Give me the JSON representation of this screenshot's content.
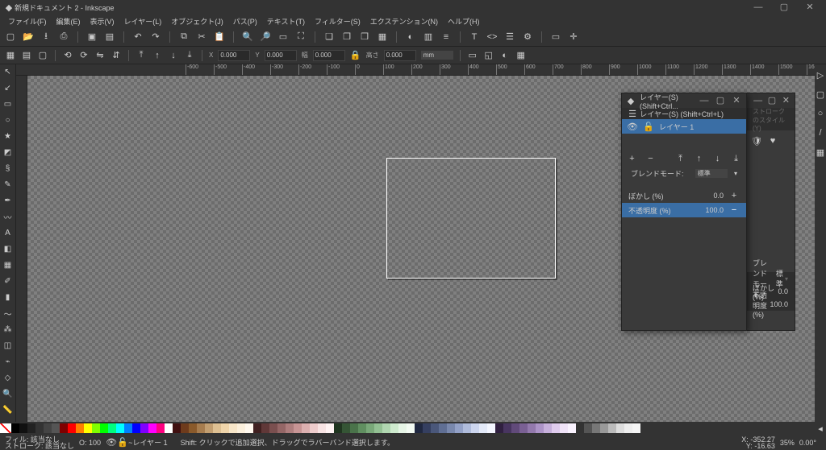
{
  "titlebar": {
    "title": "新規ドキュメント 2 - Inkscape"
  },
  "menu": {
    "file": "ファイル(F)",
    "edit": "編集(E)",
    "view": "表示(V)",
    "layer": "レイヤー(L)",
    "object": "オブジェクト(J)",
    "path": "パス(P)",
    "text": "テキスト(T)",
    "filter": "フィルター(S)",
    "extension": "エクステンション(N)",
    "help": "ヘルプ(H)"
  },
  "toolbar2": {
    "x_lbl": "X",
    "x": "0.000",
    "y_lbl": "Y",
    "y": "0.000",
    "w_lbl": "幅",
    "w": "0.000",
    "h_lbl": "高さ",
    "h": "0.000",
    "unit": "mm"
  },
  "panel_layers": {
    "title": "レイヤー(S) (Shift+Ctrl...",
    "subtitle": "レイヤー(S) (Shift+Ctrl+L)",
    "layer_name": "レイヤー 1",
    "blend_label": "ブレンドモード:",
    "blend_val": "標準",
    "blur_label": "ぼかし (%)",
    "blur_val": "0.0",
    "opacity_label": "不透明度 (%)",
    "opacity_val": "100.0"
  },
  "panel_fill": {
    "stroke_style": "ストロークのスタイル(Y)",
    "blend_label": "ブレンドモード:",
    "blend_val": "標準",
    "blur_label": "ぼかし (%)",
    "blur_val": "0.0",
    "opacity_label": "不透明度(%)",
    "opacity_val": "100.0"
  },
  "status": {
    "fill_lbl": "フィル:",
    "fill_val": "該当なし",
    "stroke_lbl": "ストローク:",
    "stroke_val": "該当なし",
    "opacity": "O: 100",
    "layer": "~レイヤー 1",
    "hint": "Shift: クリックで追加選択、ドラッグでラバーバンド選択します。",
    "x_lbl": "X:",
    "x": "-352.27",
    "y_lbl": "Y:",
    "y": "-16.63",
    "zoom": "35%",
    "rot": "0.00°"
  },
  "palette_colors": [
    "#000",
    "#111",
    "#222",
    "#333",
    "#444",
    "#555",
    "#800000",
    "#f00",
    "#ff8000",
    "#ff0",
    "#80ff00",
    "#0f0",
    "#00ff80",
    "#0ff",
    "#0080ff",
    "#00f",
    "#8000ff",
    "#f0f",
    "#ff0080",
    "#fff",
    "#401010",
    "#6e3b1c",
    "#8a5a2b",
    "#a67c4e",
    "#c29e70",
    "#dec092",
    "#f0d5aa",
    "#f8e6c8",
    "#fcf0dc",
    "#fff8ee",
    "#402020",
    "#603838",
    "#7a4f4f",
    "#946666",
    "#ad7d7d",
    "#c79494",
    "#dcb0b0",
    "#eecccc",
    "#f8e3e3",
    "#fff3f3",
    "#203520",
    "#355535",
    "#4a734a",
    "#608f60",
    "#79a879",
    "#93c093",
    "#b0d6b0",
    "#ceeace",
    "#e6f5e6",
    "#f3fbf3",
    "#202840",
    "#353f60",
    "#4a577a",
    "#606f94",
    "#7988ad",
    "#93a1c7",
    "#b0bcdc",
    "#ccd5ee",
    "#e3e9f8",
    "#f3f6ff",
    "#302040",
    "#483560",
    "#614a7a",
    "#7a6094",
    "#9379ad",
    "#ac93c7",
    "#c7b0dc",
    "#e0ccee",
    "#f0e3f8",
    "#faf3ff",
    "#333",
    "#555",
    "#777",
    "#999",
    "#bbb",
    "#ddd",
    "#eee",
    "#f5f5f5"
  ],
  "chart_data": null
}
